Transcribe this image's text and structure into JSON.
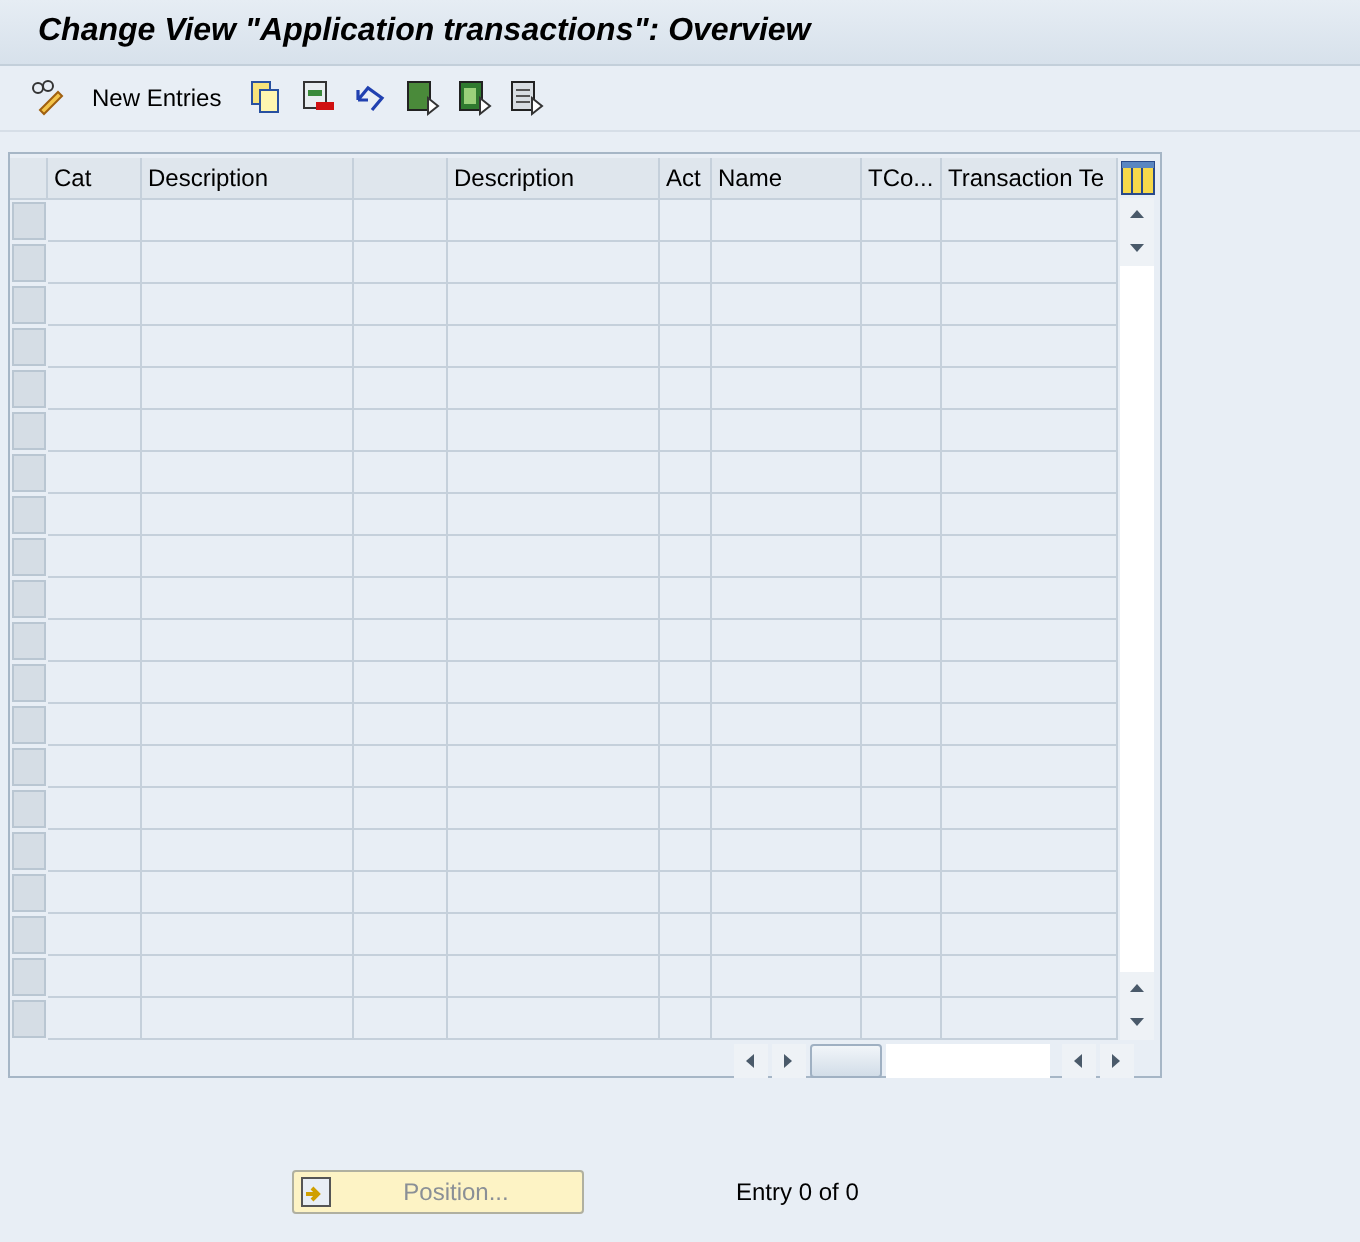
{
  "window": {
    "title": "Change View \"Application transactions\": Overview"
  },
  "toolbar": {
    "items": [
      {
        "kind": "edit"
      },
      {
        "kind": "text",
        "label": "New Entries"
      },
      {
        "kind": "copy"
      },
      {
        "kind": "delete"
      },
      {
        "kind": "undo"
      },
      {
        "kind": "selectall"
      },
      {
        "kind": "selectblock"
      },
      {
        "kind": "deselect"
      }
    ]
  },
  "table": {
    "columns": [
      "Cat",
      "Description",
      "",
      "Description",
      "Act",
      "Name",
      "TCo...",
      "Transaction Te"
    ],
    "rows": [
      {
        "selected": false
      },
      {
        "selected": false
      },
      {
        "selected": false
      },
      {
        "selected": false
      },
      {
        "selected": false
      },
      {
        "selected": false
      },
      {
        "selected": false
      },
      {
        "selected": false
      },
      {
        "selected": false
      },
      {
        "selected": false
      },
      {
        "selected": false
      },
      {
        "selected": false
      },
      {
        "selected": false
      },
      {
        "selected": false
      },
      {
        "selected": false
      },
      {
        "selected": false
      },
      {
        "selected": false
      },
      {
        "selected": false
      },
      {
        "selected": false
      },
      {
        "selected": false
      }
    ]
  },
  "footer": {
    "position_button": {
      "label": "Position...",
      "disabled": true
    },
    "entry_text": "Entry 0 of 0"
  }
}
